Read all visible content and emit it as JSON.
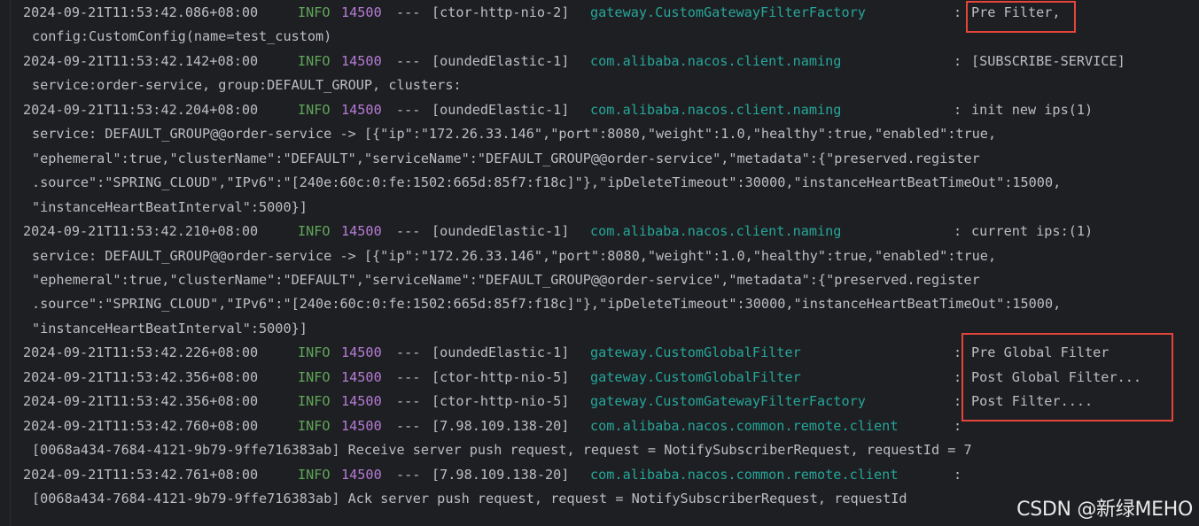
{
  "console": {
    "lines": [
      {
        "type": "log",
        "ts": "2024-09-21T11:53:42.086+08:00",
        "level": "INFO",
        "pid": "14500",
        "sep": "---",
        "thread": "[ctor-http-nio-2]",
        "logger": "gateway.CustomGatewayFilterFactory",
        "msg": "Pre Filter,"
      },
      {
        "type": "cont",
        "text": "config:CustomConfig(name=test_custom)"
      },
      {
        "type": "log",
        "ts": "2024-09-21T11:53:42.142+08:00",
        "level": "INFO",
        "pid": "14500",
        "sep": "---",
        "thread": "[oundedElastic-1]",
        "logger": "com.alibaba.nacos.client.naming",
        "msg": "[SUBSCRIBE-SERVICE]"
      },
      {
        "type": "cont",
        "text": "service:order-service, group:DEFAULT_GROUP, clusters:"
      },
      {
        "type": "log",
        "ts": "2024-09-21T11:53:42.204+08:00",
        "level": "INFO",
        "pid": "14500",
        "sep": "---",
        "thread": "[oundedElastic-1]",
        "logger": "com.alibaba.nacos.client.naming",
        "msg": "init new ips(1)"
      },
      {
        "type": "cont",
        "text": "service: DEFAULT_GROUP@@order-service -> [{\"ip\":\"172.26.33.146\",\"port\":8080,\"weight\":1.0,\"healthy\":true,\"enabled\":true,"
      },
      {
        "type": "cont",
        "text": "\"ephemeral\":true,\"clusterName\":\"DEFAULT\",\"serviceName\":\"DEFAULT_GROUP@@order-service\",\"metadata\":{\"preserved.register"
      },
      {
        "type": "cont",
        "text": ".source\":\"SPRING_CLOUD\",\"IPv6\":\"[240e:60c:0:fe:1502:665d:85f7:f18c]\"},\"ipDeleteTimeout\":30000,\"instanceHeartBeatTimeOut\":15000,"
      },
      {
        "type": "cont",
        "text": "\"instanceHeartBeatInterval\":5000}]"
      },
      {
        "type": "log",
        "ts": "2024-09-21T11:53:42.210+08:00",
        "level": "INFO",
        "pid": "14500",
        "sep": "---",
        "thread": "[oundedElastic-1]",
        "logger": "com.alibaba.nacos.client.naming",
        "msg": "current ips:(1)"
      },
      {
        "type": "cont",
        "text": "service: DEFAULT_GROUP@@order-service -> [{\"ip\":\"172.26.33.146\",\"port\":8080,\"weight\":1.0,\"healthy\":true,\"enabled\":true,"
      },
      {
        "type": "cont",
        "text": "\"ephemeral\":true,\"clusterName\":\"DEFAULT\",\"serviceName\":\"DEFAULT_GROUP@@order-service\",\"metadata\":{\"preserved.register"
      },
      {
        "type": "cont",
        "text": ".source\":\"SPRING_CLOUD\",\"IPv6\":\"[240e:60c:0:fe:1502:665d:85f7:f18c]\"},\"ipDeleteTimeout\":30000,\"instanceHeartBeatTimeOut\":15000,"
      },
      {
        "type": "cont",
        "text": "\"instanceHeartBeatInterval\":5000}]"
      },
      {
        "type": "log",
        "ts": "2024-09-21T11:53:42.226+08:00",
        "level": "INFO",
        "pid": "14500",
        "sep": "---",
        "thread": "[oundedElastic-1]",
        "logger": "gateway.CustomGlobalFilter",
        "msg": "Pre Global Filter"
      },
      {
        "type": "log",
        "ts": "2024-09-21T11:53:42.356+08:00",
        "level": "INFO",
        "pid": "14500",
        "sep": "---",
        "thread": "[ctor-http-nio-5]",
        "logger": "gateway.CustomGlobalFilter",
        "msg": "Post Global Filter..."
      },
      {
        "type": "log",
        "ts": "2024-09-21T11:53:42.356+08:00",
        "level": "INFO",
        "pid": "14500",
        "sep": "---",
        "thread": "[ctor-http-nio-5]",
        "logger": "gateway.CustomGatewayFilterFactory",
        "msg": "Post Filter...."
      },
      {
        "type": "log",
        "ts": "2024-09-21T11:53:42.760+08:00",
        "level": "INFO",
        "pid": "14500",
        "sep": "---",
        "thread": "[7.98.109.138-20]",
        "logger": "com.alibaba.nacos.common.remote.client",
        "msg": ""
      },
      {
        "type": "cont",
        "text": "[0068a434-7684-4121-9b79-9ffe716383ab] Receive server push request, request = NotifySubscriberRequest, requestId = 7"
      },
      {
        "type": "log",
        "ts": "2024-09-21T11:53:42.761+08:00",
        "level": "INFO",
        "pid": "14500",
        "sep": "---",
        "thread": "[7.98.109.138-20]",
        "logger": "com.alibaba.nacos.common.remote.client",
        "msg": ""
      },
      {
        "type": "cont",
        "text": "[0068a434-7684-4121-9b79-9ffe716383ab] Ack server push request, request = NotifySubscriberRequest, requestId"
      }
    ],
    "colors": {
      "background": "#1e1f22",
      "text": "#bcbec4",
      "info": "#5fa65a",
      "pid": "#b57bd6",
      "logger": "#26a69a",
      "highlight_border": "#e5443b"
    }
  },
  "watermark": {
    "text": "CSDN @新绿MEHO"
  }
}
